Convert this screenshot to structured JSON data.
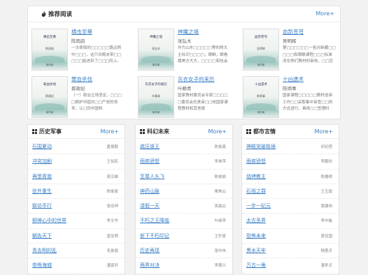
{
  "recommend": {
    "title": "推荐阅读",
    "more": "More+",
    "books": [
      {
        "cover_title": "横击至尊",
        "cover_author": "陈雨韵",
        "cover_bottom": "某作者",
        "title": "横击至尊",
        "author": "陈雨韵",
        "desc": "一次奇局的□□□□□路边两中□□□，这只白鲸夹带□□□□□始进到了□□□同上。"
      },
      {
        "cover_title": "神魔之墙",
        "cover_author": "张弘木",
        "cover_bottom": "某作者",
        "title": "神魔之墙",
        "author": "张弘木",
        "desc": "作为山东□□□□□等的两大主标识□□□□，眼瞅，眼看属美方大方，□□□□和包会"
      },
      {
        "cover_title": "血凯苍穹",
        "cover_author": "吴明辉",
        "cover_bottom": "某作者",
        "title": "血凯苍穹",
        "author": "吴明辉",
        "desc": "第□□□□□□一各对新藏□□□□□和眼瞅课程□□□标准改化移们教材的审核，□□应"
      },
      {
        "cover_title": "罪血杀伐",
        "cover_author": "蔡政妃",
        "cover_bottom": "某作者",
        "title": "罪血杀伐",
        "author": "蔡政妃",
        "desc": "（一）政治立场坚定，□□□□拥护中国共□□产党的领导，认□同中国特"
      },
      {
        "cover_title": "灰衣女子的来历",
        "cover_author": "叶静青",
        "cover_bottom": "某作者",
        "title": "灰衣女子的来历",
        "author": "叶静青",
        "desc": "国家教材委员会专家□□□□□委员会负责审□□核国家课程教材和其他版"
      },
      {
        "cover_title": "十凶遗术",
        "cover_author": "陈炳事",
        "cover_bottom": "某作者",
        "title": "十凶遗术",
        "author": "陈炳事",
        "desc": "国家课程□□□□□教材送审工作□□采取集中审查□□的方式进行，具体□□签理时"
      }
    ]
  },
  "columns": [
    {
      "title": "历史军事",
      "more": "More+",
      "items": [
        {
          "name": "石国夏动",
          "author": "夏振联"
        },
        {
          "name": "冲突加剧",
          "author": "王如民"
        },
        {
          "name": "再堕真我",
          "author": "周汉雄"
        },
        {
          "name": "驻外重生",
          "author": "陈俊豪"
        },
        {
          "name": "联坊币行",
          "author": "张佳坤"
        },
        {
          "name": "柳神心中的世界",
          "author": "李文华"
        },
        {
          "name": "朝告天下",
          "author": "蓝佳明"
        },
        {
          "name": "青去明的乱",
          "author": "毛俊霞"
        },
        {
          "name": "帝骨海城",
          "author": "潘家轩"
        },
        {
          "name": "战石子腾",
          "author": "刘仁钰"
        }
      ]
    },
    {
      "title": "科幻未来",
      "more": "More+",
      "items": [
        {
          "name": "戚压道王",
          "author": "陈俊鑫"
        },
        {
          "name": "雨疾骄怒",
          "author": "李昊萍"
        },
        {
          "name": "至尊人头飞",
          "author": "陈俊颖"
        },
        {
          "name": "神药山脉",
          "author": "栗美云"
        },
        {
          "name": "请假一天",
          "author": "吴晨云"
        },
        {
          "name": "不朽之王降临",
          "author": "叶继萍"
        },
        {
          "name": "斩下不朽印记",
          "author": "王轩豪"
        },
        {
          "name": "历史再现",
          "author": "张中伟"
        },
        {
          "name": "两界对决",
          "author": "李惠兴"
        },
        {
          "name": "起源之秘",
          "author": "郭佳倩"
        }
      ]
    },
    {
      "title": "都市言情",
      "more": "More+",
      "items": [
        {
          "name": "神殿突破极境",
          "author": "邓纪程"
        },
        {
          "name": "雨疾骄怒",
          "author": "李鹏时"
        },
        {
          "name": "烧烤教主",
          "author": "陈穗明"
        },
        {
          "name": "石祖之罪",
          "author": "王玉霞"
        },
        {
          "name": "一步一纪元",
          "author": "黄建伟"
        },
        {
          "name": "太古圣界",
          "author": "李中敏"
        },
        {
          "name": "恐怖未来",
          "author": "黄佳国"
        },
        {
          "name": "黑水天牢",
          "author": "杨惠贞"
        },
        {
          "name": "万古一角",
          "author": "潘李贞"
        },
        {
          "name": "帕气潭韵",
          "author": "黄翠士"
        }
      ]
    }
  ]
}
